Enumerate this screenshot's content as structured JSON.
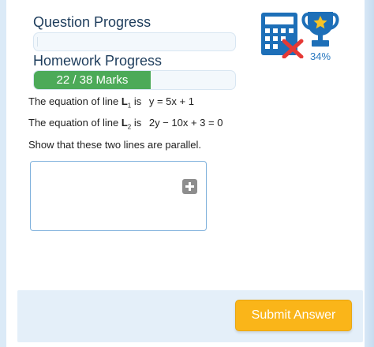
{
  "progress": {
    "question_label": "Question Progress",
    "homework_label": "Homework Progress",
    "homework_marks": "22 / 38 Marks",
    "homework_fraction": 0.58
  },
  "stats": {
    "percent": "34%",
    "calculator_icon": "calculator-not-allowed-icon",
    "trophy_icon": "trophy-icon"
  },
  "question": {
    "line1_prefix": "The equation of line ",
    "line1_name": "L",
    "line1_sub": "1",
    "line1_is": " is ",
    "line1_equation": "y = 5x + 1",
    "line2_prefix": "The equation of line ",
    "line2_name": "L",
    "line2_sub": "2",
    "line2_is": " is ",
    "line2_equation": "2y − 10x + 3 = 0",
    "instruction": "Show that these two lines are parallel."
  },
  "actions": {
    "submit_label": "Submit Answer"
  },
  "colors": {
    "progress_fill": "#4caa58",
    "submit_button": "#fab519",
    "accent_blue": "#2a79c0",
    "error_red": "#e53935"
  }
}
